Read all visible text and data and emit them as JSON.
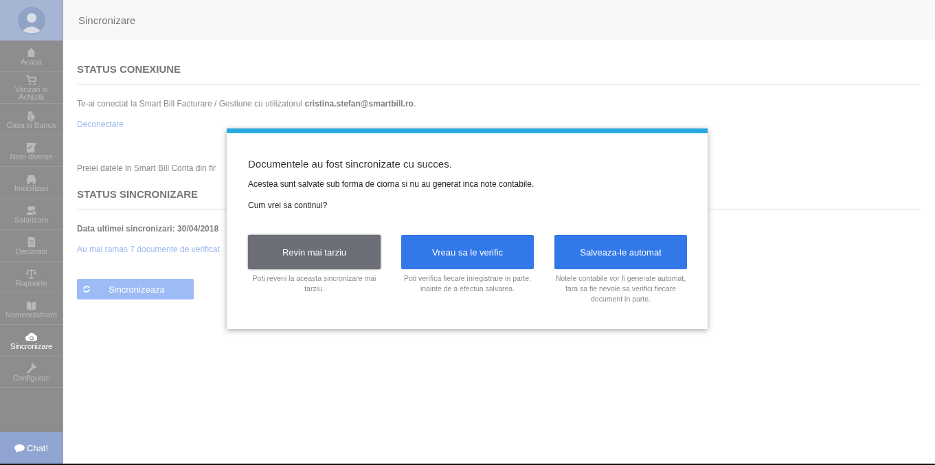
{
  "header": {
    "title": "Sincronizare"
  },
  "sidebar": {
    "items": [
      {
        "label": "Acasa",
        "selected": false
      },
      {
        "label": "Vanzari si Achizitii",
        "selected": false
      },
      {
        "label": "Casa si Banca",
        "selected": false
      },
      {
        "label": "Note diverse",
        "selected": false
      },
      {
        "label": "Imobilizari",
        "selected": false
      },
      {
        "label": "Salarizare",
        "selected": false
      },
      {
        "label": "Declaratii",
        "selected": false
      },
      {
        "label": "Rapoarte",
        "selected": false
      },
      {
        "label": "Nomenclatoare",
        "selected": false
      },
      {
        "label": "Sincronizare",
        "selected": true
      },
      {
        "label": "Configurari",
        "selected": false
      }
    ],
    "chat": "Chat!"
  },
  "connection": {
    "heading": "STATUS CONEXIUNE",
    "text": "Te-ai conectat la Smart Bill Facturare / Gestiune cu utilizatorul **cristina.stefan@smartbill.ro**.",
    "link": "Deconectare",
    "import_text": "Preiei datele in Smart Bill Conta din fir"
  },
  "sync": {
    "heading": "STATUS SINCRONIZARE",
    "last_sync": "Data ultimei sincronizari: 30/04/2018",
    "remaining_link": "Au mai ramas 7 documente de verificat",
    "button": "Sincronizeaza"
  },
  "dialog": {
    "title": "Documentele au fost sincronizate cu succes.",
    "message": "Acestea sunt salvate sub forma de ciorna si nu au generat inca note contabile.",
    "question": "Cum vrei sa continui?",
    "options": [
      {
        "label": "Revin mai tarziu",
        "kind": "secondary",
        "hint": "Poti reveni la aceasta sincronizare mai tarziu."
      },
      {
        "label": "Vreau sa le verific",
        "kind": "primary",
        "hint": "Poti verifica fiecare inregistrare in parte, inainte de a efectua salvarea."
      },
      {
        "label": "Salveaza-le automat",
        "kind": "primary",
        "hint": "Notele contabile vor fi generate automat, fara sa fie nevoie sa verifici fiecare document in parte."
      }
    ]
  }
}
